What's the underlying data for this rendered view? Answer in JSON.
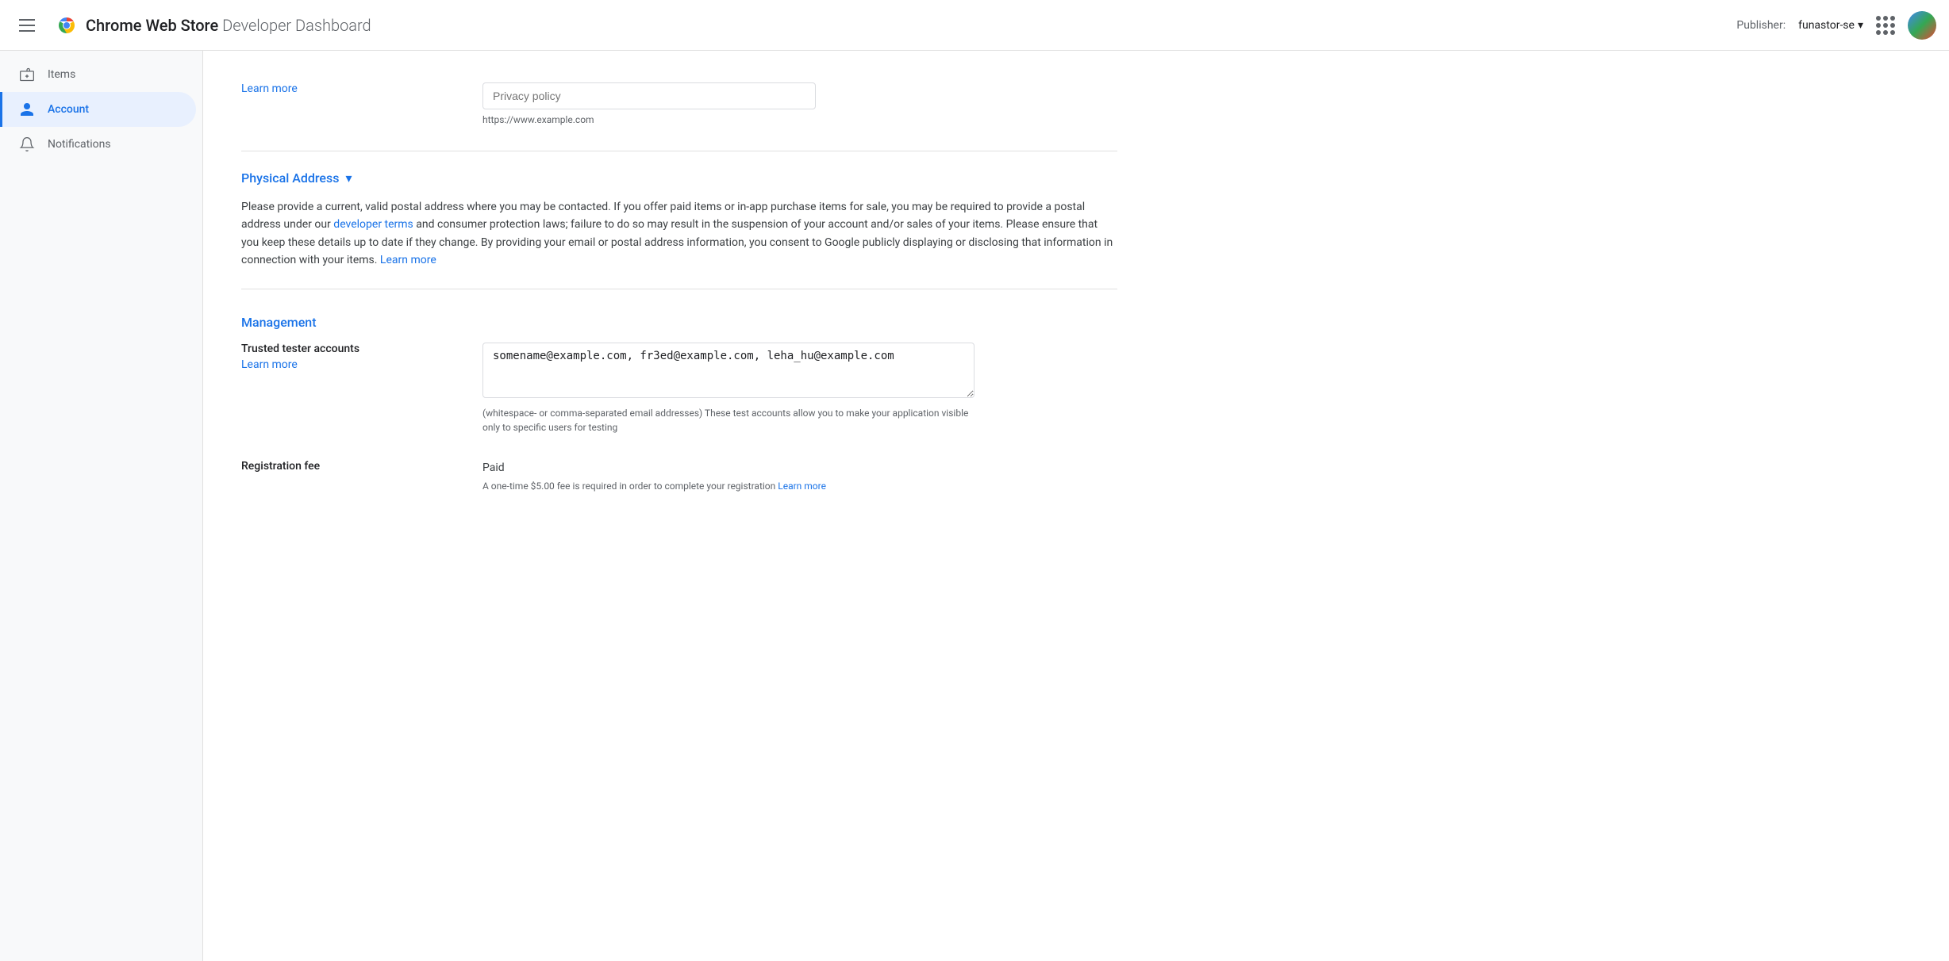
{
  "header": {
    "hamburger_label": "menu",
    "app_name": "Chrome Web Store",
    "app_subtitle": "Developer Dashboard",
    "publisher_label": "Publisher:",
    "publisher_name": "funastor-se",
    "grid_icon_label": "apps",
    "avatar_label": "user avatar"
  },
  "sidebar": {
    "items": [
      {
        "id": "items",
        "label": "Items",
        "icon": "package-icon",
        "active": false
      },
      {
        "id": "account",
        "label": "Account",
        "icon": "account-circle-icon",
        "active": true
      },
      {
        "id": "notifications",
        "label": "Notifications",
        "icon": "bell-icon",
        "active": false
      }
    ]
  },
  "content": {
    "privacy_policy": {
      "learn_more_label": "Learn more",
      "input_placeholder": "Privacy policy",
      "input_hint": "https://www.example.com"
    },
    "physical_address": {
      "section_title": "Physical Address",
      "description": "Please provide a current, valid postal address where you may be contacted. If you offer paid items or in-app purchase items for sale, you may be required to provide a postal address under our",
      "developer_terms_link": "developer terms",
      "description_cont": "and consumer protection laws; failure to do so may result in the suspension of your account and/or sales of your items. Please ensure that you keep these details up to date if they change. By providing your email or postal address information, you consent to Google publicly displaying or disclosing that information in connection with your items.",
      "learn_more_label": "Learn more"
    },
    "management": {
      "section_title": "Management",
      "trusted_tester": {
        "label": "Trusted tester accounts",
        "learn_more_label": "Learn more",
        "value": "somename@example.com, fr3ed@example.com, leha_hu@example.com",
        "hint": "(whitespace- or comma-separated email addresses) These test accounts allow you to make your application visible only to specific users for testing"
      },
      "registration_fee": {
        "label": "Registration fee",
        "value": "Paid",
        "note_prefix": "A one-time $5.00 fee is required in order to complete your registration",
        "learn_more_label": "Learn more"
      }
    }
  }
}
